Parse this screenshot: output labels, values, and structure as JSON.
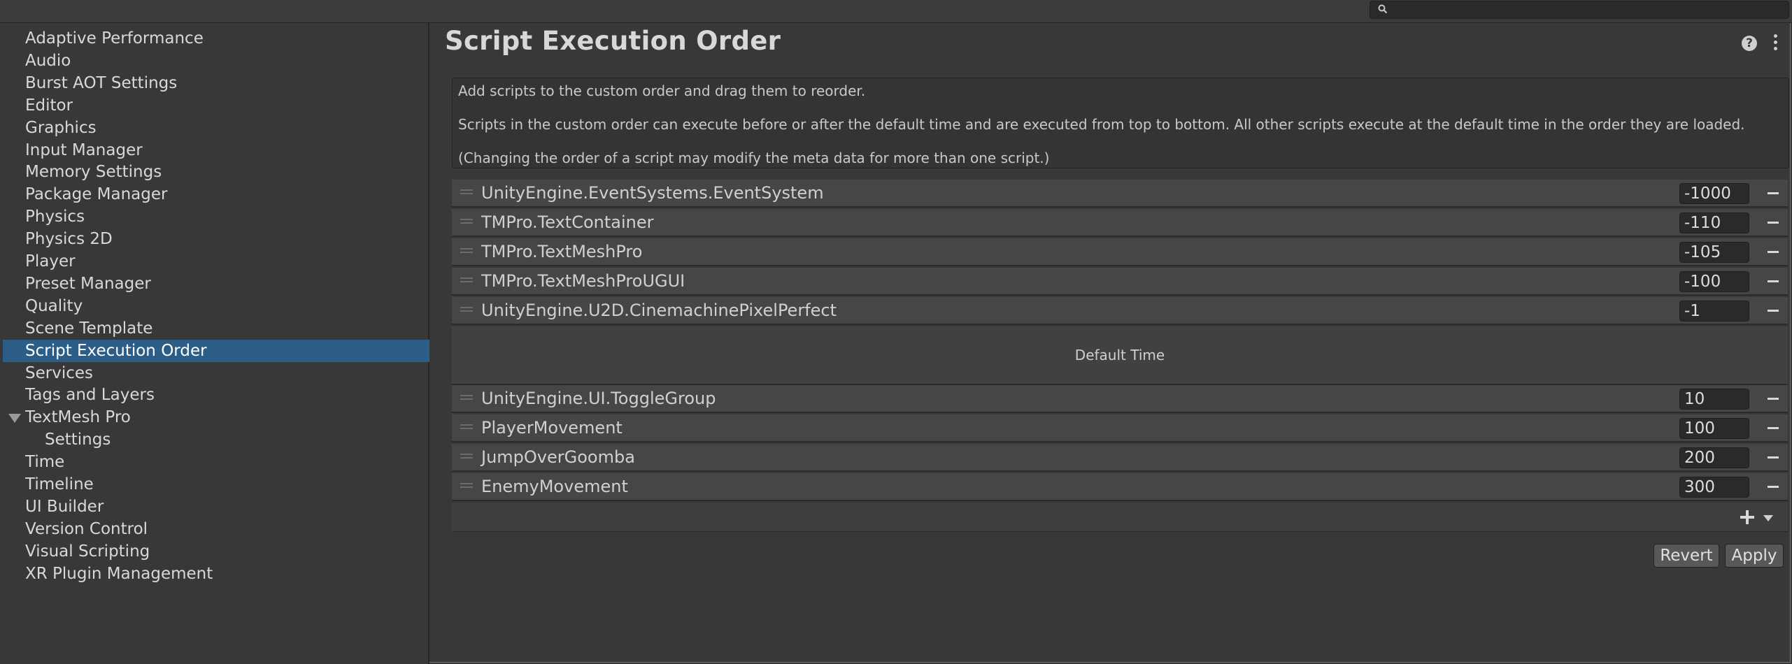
{
  "search": {
    "value": ""
  },
  "sidebar": {
    "items": [
      {
        "label": "Adaptive Performance"
      },
      {
        "label": "Audio"
      },
      {
        "label": "Burst AOT Settings"
      },
      {
        "label": "Editor"
      },
      {
        "label": "Graphics"
      },
      {
        "label": "Input Manager"
      },
      {
        "label": "Memory Settings"
      },
      {
        "label": "Package Manager"
      },
      {
        "label": "Physics"
      },
      {
        "label": "Physics 2D"
      },
      {
        "label": "Player"
      },
      {
        "label": "Preset Manager"
      },
      {
        "label": "Quality"
      },
      {
        "label": "Scene Template"
      },
      {
        "label": "Script Execution Order",
        "selected": true
      },
      {
        "label": "Services"
      },
      {
        "label": "Tags and Layers"
      },
      {
        "label": "TextMesh Pro",
        "expanded": true
      },
      {
        "label": "Settings",
        "child": true
      },
      {
        "label": "Time"
      },
      {
        "label": "Timeline"
      },
      {
        "label": "UI Builder"
      },
      {
        "label": "Version Control"
      },
      {
        "label": "Visual Scripting"
      },
      {
        "label": "XR Plugin Management"
      }
    ]
  },
  "main": {
    "title": "Script Execution Order",
    "help_icon_glyph": "?",
    "help_lines": [
      "Add scripts to the custom order and drag them to reorder.",
      "Scripts in the custom order can execute before or after the default time and are executed from top to bottom. All other scripts execute at the default time in the order they are loaded.",
      "(Changing the order of a script may modify the meta data for more than one script.)"
    ],
    "before_default": [
      {
        "name": "UnityEngine.EventSystems.EventSystem",
        "order": "-1000"
      },
      {
        "name": "TMPro.TextContainer",
        "order": "-110"
      },
      {
        "name": "TMPro.TextMeshPro",
        "order": "-105"
      },
      {
        "name": "TMPro.TextMeshProUGUI",
        "order": "-100"
      },
      {
        "name": "UnityEngine.U2D.CinemachinePixelPerfect",
        "order": "-1"
      }
    ],
    "default_time_label": "Default Time",
    "after_default": [
      {
        "name": "UnityEngine.UI.ToggleGroup",
        "order": "10"
      },
      {
        "name": "PlayerMovement",
        "order": "100"
      },
      {
        "name": "JumpOverGoomba",
        "order": "200"
      },
      {
        "name": "EnemyMovement",
        "order": "300"
      }
    ],
    "revert_label": "Revert",
    "apply_label": "Apply"
  },
  "colors": {
    "background": "#383838",
    "selection": "#2c5d87",
    "row": "#464646",
    "input": "#2a2a2a"
  }
}
